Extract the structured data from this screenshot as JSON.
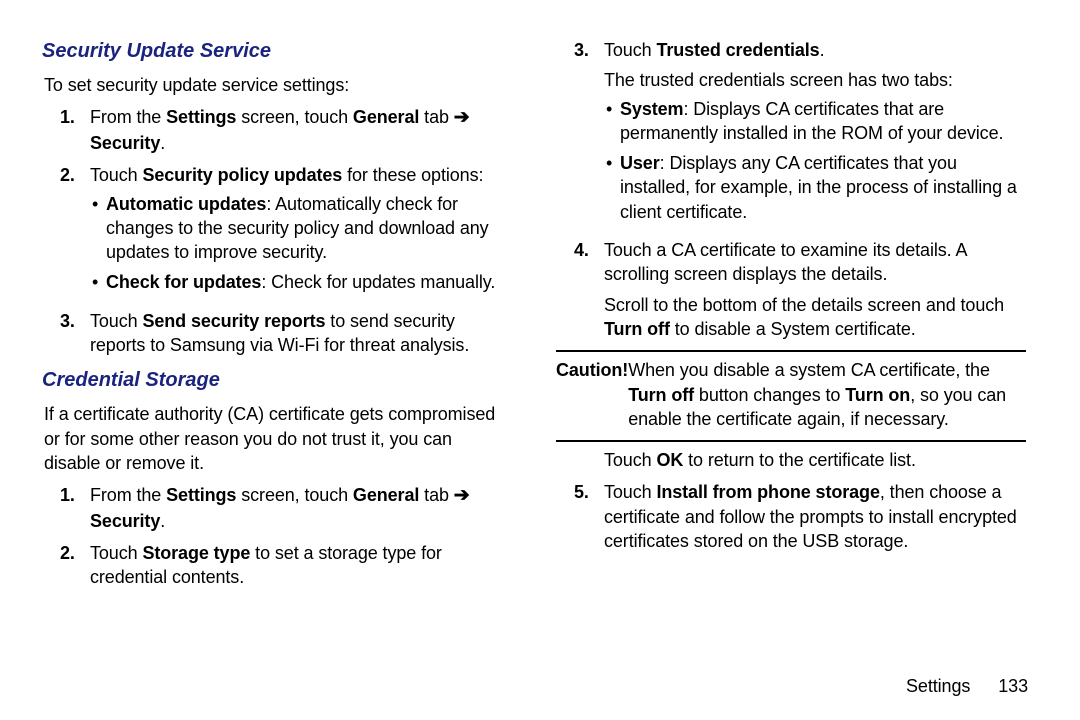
{
  "left": {
    "h1": "Security Update Service",
    "intro1": "To set security update service settings:",
    "l1": {
      "num": "1.",
      "a": "From the ",
      "b": "Settings",
      "c": " screen, touch ",
      "d": "General",
      "e": " tab ",
      "arrow": "➔",
      "f": "Security",
      "g": "."
    },
    "l2": {
      "num": "2.",
      "a": "Touch ",
      "b": "Security policy updates",
      "c": " for these options:",
      "b1a": "Automatic updates",
      "b1b": ": Automatically check for changes to the security policy and download any updates to improve security.",
      "b2a": "Check for updates",
      "b2b": ": Check for updates manually."
    },
    "l3": {
      "num": "3.",
      "a": "Touch ",
      "b": "Send security reports",
      "c": " to send security reports to Samsung via Wi-Fi for threat analysis."
    },
    "h2": "Credential Storage",
    "intro2": "If a certificate authority (CA) certificate gets compromised or for some other reason you do not trust it, you can disable or remove it.",
    "c1": {
      "num": "1.",
      "a": "From the ",
      "b": "Settings",
      "c": " screen, touch ",
      "d": "General",
      "e": " tab ",
      "arrow": "➔",
      "f": "Security",
      "g": "."
    },
    "c2": {
      "num": "2.",
      "a": "Touch ",
      "b": "Storage type",
      "c": " to set a storage type for credential contents."
    }
  },
  "right": {
    "r3": {
      "num": "3.",
      "a": "Touch ",
      "b": "Trusted credentials",
      "c": ".",
      "d": "The trusted credentials screen has two tabs:",
      "sysA": "System",
      "sysB": ": Displays CA certificates that are permanently installed in the ROM of your device.",
      "usrA": "User",
      "usrB": ": Displays any CA certificates that you installed, for example, in the process of installing a client certificate."
    },
    "r4": {
      "num": "4.",
      "a": "Touch a CA certificate to examine its details. A scrolling screen displays the details.",
      "b": "Scroll to the bottom of the details screen and touch ",
      "c": "Turn off",
      "d": " to disable a System certificate."
    },
    "caution": {
      "label": "Caution!",
      "a": " When you disable a system CA certificate, the ",
      "b": "Turn off",
      "c": " button changes to ",
      "d": "Turn on",
      "e": ", so you can enable the certificate again, if necessary."
    },
    "r4b": {
      "a": "Touch ",
      "b": "OK",
      "c": " to return to the certificate list."
    },
    "r5": {
      "num": "5.",
      "a": "Touch ",
      "b": "Install from phone storage",
      "c": ", then choose a certificate and follow the prompts to install encrypted certificates stored on the USB storage."
    }
  },
  "footer": {
    "section": "Settings",
    "page": "133"
  }
}
